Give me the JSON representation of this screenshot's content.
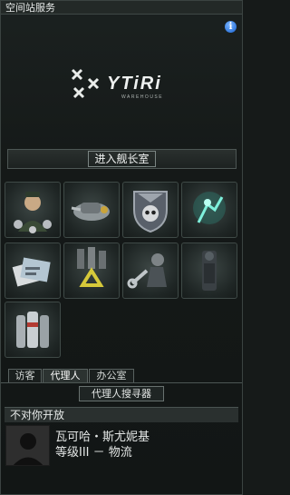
{
  "window": {
    "title": "空间站服务"
  },
  "logo": {
    "name": "YTiRi",
    "subtitle": "WAREHOUSE"
  },
  "main_action": {
    "label": "进入舰长室"
  },
  "services": [
    {
      "name": "medal-officer-icon"
    },
    {
      "name": "drone-repair-icon"
    },
    {
      "name": "skull-shield-emblem-icon"
    },
    {
      "name": "clone-hologram-icon"
    },
    {
      "name": "documents-market-icon"
    },
    {
      "name": "recycle-reprocessing-icon"
    },
    {
      "name": "mechanic-repair-icon"
    },
    {
      "name": "dark-figure-security-icon"
    },
    {
      "name": "canisters-fitting-icon"
    }
  ],
  "tabs": [
    {
      "label": "访客",
      "active": false
    },
    {
      "label": "代理人",
      "active": true
    },
    {
      "label": "办公室",
      "active": false
    }
  ],
  "agent_finder": {
    "label": "代理人搜寻器"
  },
  "section": {
    "title": "不对你开放"
  },
  "agent": {
    "name": "瓦可哈・斯尤妮基",
    "level": "等级III － 物流"
  },
  "colors": {
    "accent": "#1660d0",
    "panel_bg": "#161a19",
    "border": "#4d5654"
  }
}
